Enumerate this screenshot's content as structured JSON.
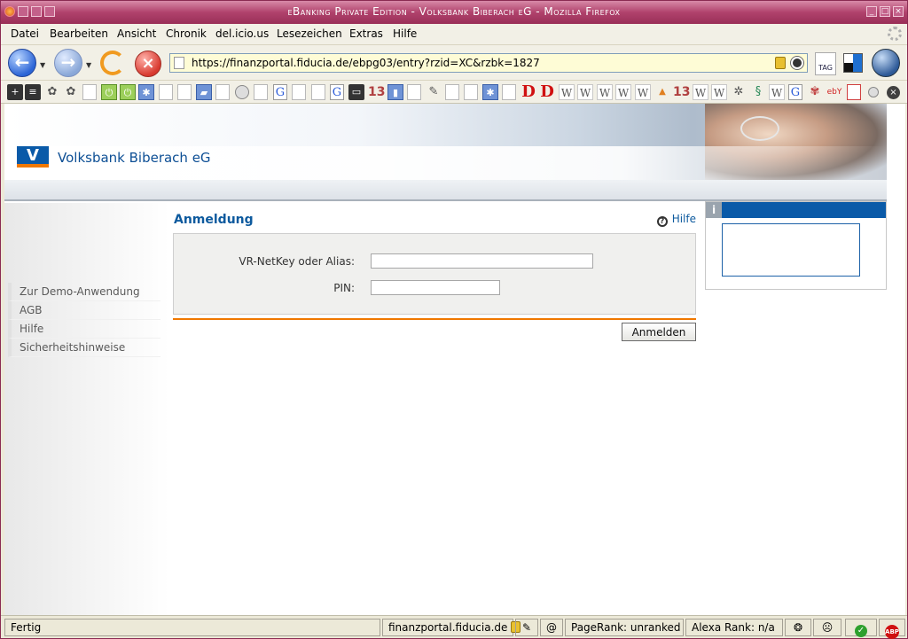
{
  "window": {
    "title": "eBanking Private Edition - Volksbank Biberach eG - Mozilla Firefox"
  },
  "menubar": {
    "items": [
      "Datei",
      "Bearbeiten",
      "Ansicht",
      "Chronik",
      "del.icio.us",
      "Lesezeichen",
      "Extras",
      "Hilfe"
    ]
  },
  "navbar": {
    "url": "https://finanzportal.fiducia.de/ebpg03/entry?rzid=XC&rzbk=1827",
    "tag_label": "TAG"
  },
  "bookmarks": {
    "glyphs": [
      "W",
      "D",
      "G",
      "13",
      "ebY"
    ]
  },
  "page": {
    "bank_name": "Volksbank Biberach eG",
    "heading": "Anmeldung",
    "help_label": "Hilfe",
    "form": {
      "netkey_label": "VR-NetKey oder Alias:",
      "netkey_value": "",
      "pin_label": "PIN:",
      "pin_value": "",
      "submit_label": "Anmelden"
    },
    "left_nav": [
      "Zur Demo-Anwendung",
      "AGB",
      "Hilfe",
      "Sicherheitshinweise"
    ]
  },
  "statusbar": {
    "status": "Fertig",
    "domain": "finanzportal.fiducia.de",
    "pagerank": "PageRank: unranked",
    "alexa": "Alexa Rank: n/a",
    "abp": "ABP"
  }
}
